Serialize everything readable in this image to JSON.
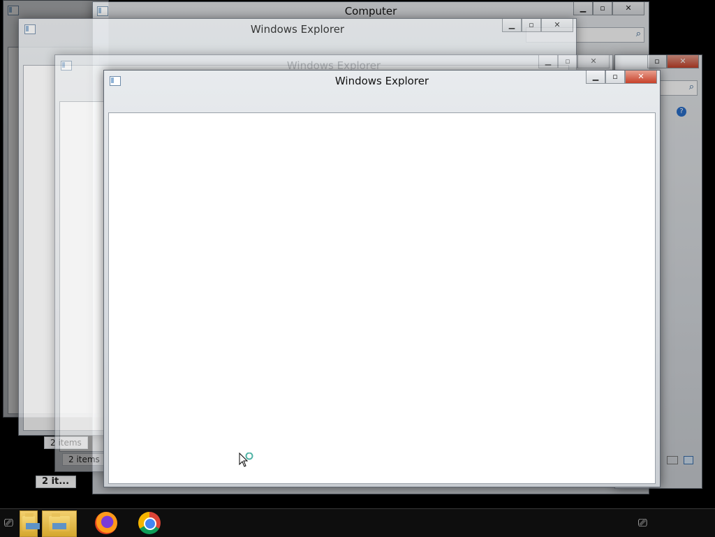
{
  "windows": [
    {
      "title": "Computer"
    },
    {
      "title": "Windows Explorer"
    },
    {
      "title": "Windows Explorer"
    },
    {
      "title": "Windows Explorer"
    }
  ],
  "status": {
    "items_a": "2 items",
    "items_b": "2 items",
    "items_c": "2 it..."
  },
  "caption": {
    "min": "▁",
    "max": "▫",
    "close": "✕"
  },
  "taskbar": {
    "items": [
      {
        "icon": "folder-icon"
      },
      {
        "icon": "folder-icon"
      },
      {
        "icon": "firefox-icon"
      },
      {
        "icon": "chrome-icon"
      }
    ],
    "tray": {
      "network_icon": "network-icon"
    }
  },
  "colors": {
    "close_button": "#c7412a",
    "taskbar": "#0e0e0e"
  }
}
